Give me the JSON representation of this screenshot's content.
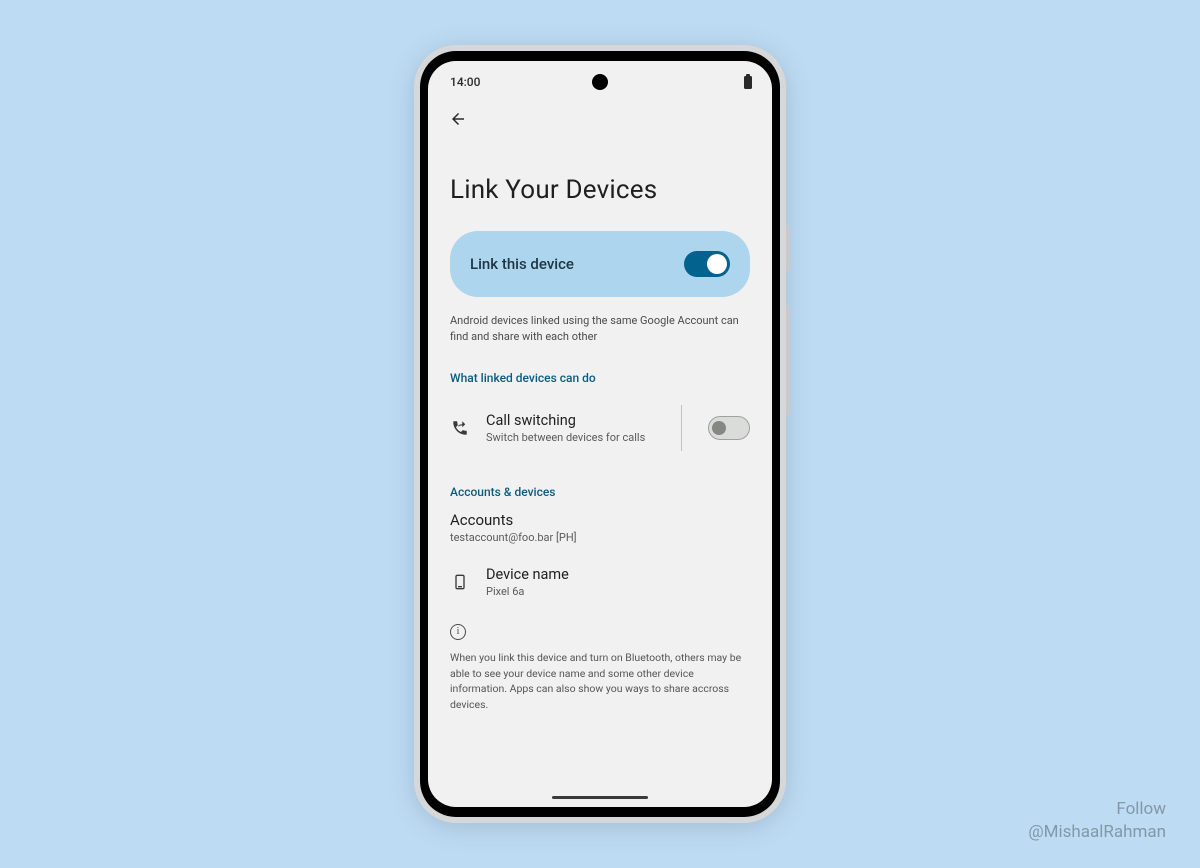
{
  "status": {
    "time": "14:00"
  },
  "page": {
    "title": "Link Your Devices",
    "primary": {
      "label": "Link this device",
      "toggle_on": true
    },
    "description": "Android devices linked using the same Google Account can find and share with each other",
    "sections": {
      "capabilities": {
        "header": "What linked devices can do",
        "call_switching": {
          "title": "Call switching",
          "subtitle": "Switch between devices for calls",
          "toggle_on": false
        }
      },
      "accounts": {
        "header": "Accounts & devices",
        "accounts_label": "Accounts",
        "accounts_value": "testaccount@foo.bar [PH]",
        "device_name_label": "Device name",
        "device_name_value": "Pixel 6a"
      }
    },
    "info": "When you link this device and turn on Bluetooth, others may be able to see your device name and some other device information. Apps can also show you ways to share accross devices."
  },
  "credit": {
    "line1": "Follow",
    "line2": "@MishaalRahman"
  }
}
